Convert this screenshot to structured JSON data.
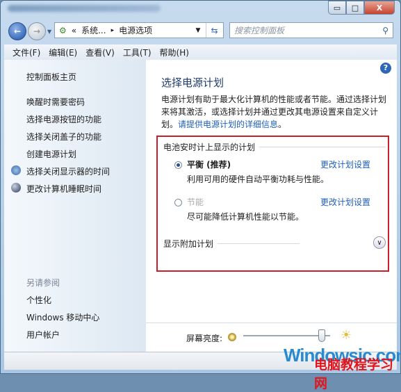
{
  "window": {
    "controls": {
      "minimize": "▭",
      "maximize": "□",
      "close": "X"
    }
  },
  "address": {
    "crumbs": [
      "«",
      "系统...",
      "▸",
      "电源选项"
    ],
    "dropdown": "▼"
  },
  "search": {
    "placeholder": "搜索控制面板"
  },
  "menu": [
    "文件(F)",
    "编辑(E)",
    "查看(V)",
    "工具(T)",
    "帮助(H)"
  ],
  "sidebar": {
    "home": "控制面板主页",
    "items": [
      "唤醒时需要密码",
      "选择电源按钮的功能",
      "选择关闭盖子的功能",
      "创建电源计划",
      "选择关闭显示器的时间",
      "更改计算机睡眠时间"
    ],
    "see_also": "另请参阅",
    "see_also_items": [
      "个性化",
      "Windows 移动中心",
      "用户帐户"
    ]
  },
  "main": {
    "title": "选择电源计划",
    "desc": "电源计划有助于最大化计算机的性能或者节能。通过选择计划来将其激活，或选择计划并通过更改其电源设置来自定义计划。",
    "desc_link": "请提供电源计划的详细信息",
    "desc_end": "。",
    "battery_section": "电池安时计上显示的计划",
    "plans": [
      {
        "name": "平衡 (推荐)",
        "desc": "利用可用的硬件自动平衡功耗与性能。",
        "link": "更改计划设置",
        "selected": true
      },
      {
        "name": "节能",
        "desc": "尽可能降低计算机性能以节能。",
        "link": "更改计划设置",
        "selected": false
      }
    ],
    "additional": "显示附加计划"
  },
  "brightness": {
    "label": "屏幕亮度:",
    "value_percent": 90
  },
  "watermark": {
    "line1": "Windowsic.com",
    "line2": "电脑教程学习网"
  },
  "colors": {
    "highlight_box": "#c8202b",
    "link": "#1f5fb8"
  }
}
